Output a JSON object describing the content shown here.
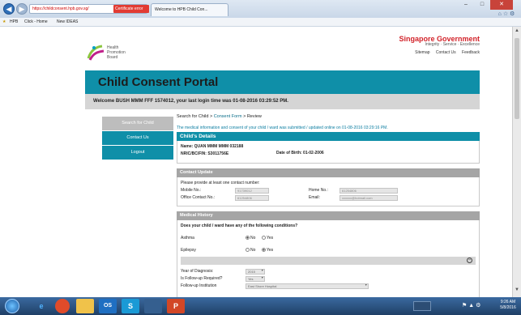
{
  "browser": {
    "url": "https://childconsent.hpb.gov.sg/",
    "certificate_label": "Certificate error",
    "tab_title": "Welcome to HPB Child Con...",
    "favorites": [
      "HPB",
      "Click - Home",
      "New IDEAS"
    ]
  },
  "site": {
    "logo_text": [
      "Health",
      "Promotion",
      "Board"
    ],
    "gov_title": "Singapore Government",
    "gov_tagline": "Integrity · Service · Excellence",
    "header_links": [
      "Sitemap",
      "Contact Us",
      "Feedback"
    ],
    "portal_title": "Child Consent Portal",
    "welcome": "Welcome BUSH MMM FFF 1574012, your last login time was 01-08-2016 03:29:52 PM."
  },
  "leftnav": [
    "Search for Child",
    "Contact Us",
    "Logout"
  ],
  "breadcrumb": {
    "prefix": "Search for Child > ",
    "link": "Consent Form",
    "suffix": " > Review"
  },
  "notice": "The medical information and consent of your child / ward was submitted / updated online on 01-08-2016 03:29:16 PM.",
  "childs_details": {
    "title": "Child's Details",
    "name": "Name: QUAN MMM MMM 032188",
    "nric": "NRIC/BC/FIN: S3011756E",
    "dob": "Date of Birth: 01-02-2006"
  },
  "contact_update": {
    "title": "Contact Update",
    "instruction": "Please provide at least one contact number:",
    "mobile_label": "Mobile No.:",
    "mobile_value": "91739012",
    "home_label": "Home No.:",
    "home_value": "61254806",
    "office_label": "Office Contact No.:",
    "office_value": "61254806",
    "email_label": "Email:",
    "email_value": "xxxxxx@hotmail.com"
  },
  "medical_history": {
    "title": "Medical History",
    "question": "Does your child / ward have any of the following conditions?",
    "conditions": [
      {
        "name": "Asthma",
        "yes": "Yes",
        "no": "No",
        "selected": "No"
      },
      {
        "name": "Epilepsy",
        "yes": "Yes",
        "no": "No",
        "selected": "Yes"
      }
    ],
    "year_label": "Year of Diagnosis:",
    "year_value": "2015",
    "followup_label": "Is Follow-up Required?",
    "followup_value": "Yes",
    "institution_label": "Follow-up Institution",
    "institution_value": "East Shore Hospital"
  },
  "taskbar": {
    "apps": [
      "e",
      "O",
      "",
      "OS",
      "S",
      "",
      "P"
    ],
    "time": "9:26 AM",
    "date": "5/8/2016"
  }
}
